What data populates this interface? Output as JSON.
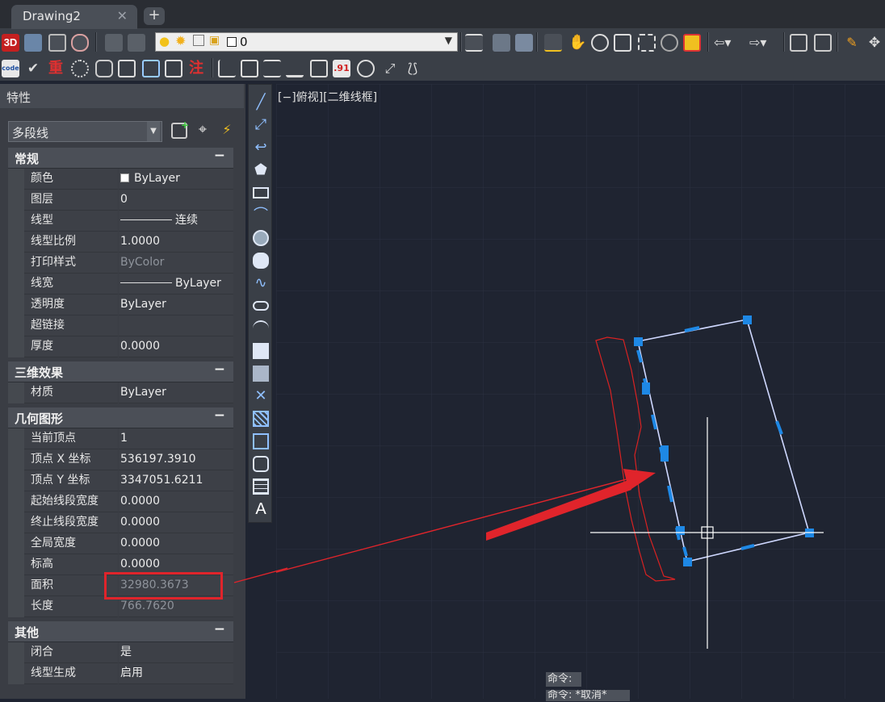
{
  "tab": {
    "title": "Drawing2",
    "close": "✕",
    "add": "+"
  },
  "layer_combo": {
    "value": "0"
  },
  "panel": {
    "title": "特性",
    "object_type": "多段线",
    "sections": {
      "general": {
        "title": "常规",
        "toggle": "−",
        "rows": [
          {
            "key": "颜色",
            "value": "ByLayer"
          },
          {
            "key": "图层",
            "value": "0"
          },
          {
            "key": "线型",
            "value": "连续"
          },
          {
            "key": "线型比例",
            "value": "1.0000"
          },
          {
            "key": "打印样式",
            "value": "ByColor"
          },
          {
            "key": "线宽",
            "value": "ByLayer"
          },
          {
            "key": "透明度",
            "value": "ByLayer"
          },
          {
            "key": "超链接",
            "value": ""
          },
          {
            "key": "厚度",
            "value": "0.0000"
          }
        ]
      },
      "threed": {
        "title": "三维效果",
        "toggle": "−",
        "rows": [
          {
            "key": "材质",
            "value": "ByLayer"
          }
        ]
      },
      "geometry": {
        "title": "几何图形",
        "toggle": "−",
        "rows": [
          {
            "key": "当前顶点",
            "value": "1"
          },
          {
            "key": "顶点 X 坐标",
            "value": "536197.3910"
          },
          {
            "key": "顶点 Y 坐标",
            "value": "3347051.6211"
          },
          {
            "key": "起始线段宽度",
            "value": "0.0000"
          },
          {
            "key": "终止线段宽度",
            "value": "0.0000"
          },
          {
            "key": "全局宽度",
            "value": "0.0000"
          },
          {
            "key": "标高",
            "value": "0.0000"
          },
          {
            "key": "面积",
            "value": "32980.3673"
          },
          {
            "key": "长度",
            "value": "766.7620"
          }
        ]
      },
      "other": {
        "title": "其他",
        "toggle": "−",
        "rows": [
          {
            "key": "闭合",
            "value": "是"
          },
          {
            "key": "线型生成",
            "value": "启用"
          }
        ]
      }
    }
  },
  "viewport": {
    "label": "[−]俯视][二维线框]"
  },
  "command": {
    "line1": "命令:",
    "line2": "命令: *取消*"
  },
  "colors": {
    "accent_selection": "#1e88e5",
    "highlight_box": "#e0242b",
    "arrow": "#e0242b"
  }
}
